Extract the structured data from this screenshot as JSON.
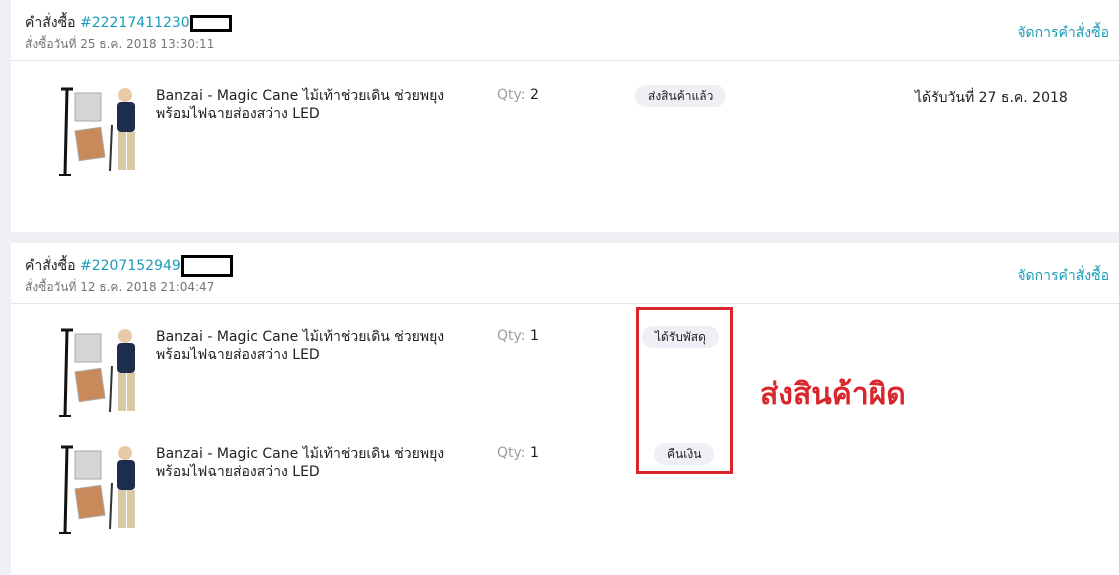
{
  "orders": [
    {
      "title_label": "คำสั่งซื้อ",
      "order_number": "#22217411230",
      "order_date": "สั่งซื้อวันที่ 25 ธ.ค. 2018 13:30:11",
      "manage_label": "จัดการคำสั่งซื้อ",
      "items": [
        {
          "name": "Banzai - Magic Cane ไม้เท้าช่วยเดิน ช่วยพยุง พร้อมไฟฉายส่องสว่าง LED",
          "qty_label": "Qty:",
          "qty": "2",
          "status": "ส่งสินค้าแล้ว",
          "delivered": "ได้รับวันที่ 27 ธ.ค. 2018"
        }
      ]
    },
    {
      "title_label": "คำสั่งซื้อ",
      "order_number": "#2207152949",
      "order_date": "สั่งซื้อวันที่ 12 ธ.ค. 2018 21:04:47",
      "manage_label": "จัดการคำสั่งซื้อ",
      "items": [
        {
          "name": "Banzai - Magic Cane ไม้เท้าช่วยเดิน ช่วยพยุง พร้อมไฟฉายส่องสว่าง LED",
          "qty_label": "Qty:",
          "qty": "1",
          "status": "ได้รับพัสดุ"
        },
        {
          "name": "Banzai - Magic Cane ไม้เท้าช่วยเดิน ช่วยพยุง พร้อมไฟฉายส่องสว่าง LED",
          "qty_label": "Qty:",
          "qty": "1",
          "status": "คืนเงิน"
        }
      ]
    }
  ],
  "annotation": {
    "text": "ส่งสินค้าผิด",
    "color": "#d9262c"
  },
  "colors": {
    "link": "#1a9cb7",
    "page_bg": "#eff0f5",
    "pill_bg": "#eff0f5"
  },
  "icons": {
    "redaction": "black-redaction-box"
  }
}
